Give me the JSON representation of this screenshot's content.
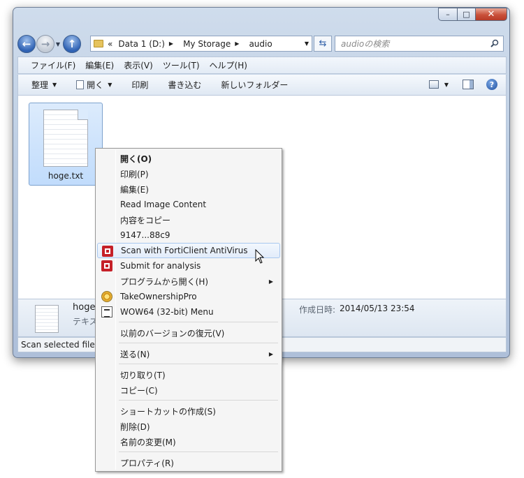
{
  "window": {
    "buttons": {
      "minimize": "–",
      "maximize": "□",
      "close": "✕"
    }
  },
  "nav": {
    "back": "←",
    "forward": "→",
    "up": "↑",
    "breadcrumb_prefix": "«",
    "breadcrumbs": [
      "Data 1 (D:)",
      "My Storage",
      "audio"
    ],
    "search_placeholder": "audioの検索"
  },
  "menubar": [
    "ファイル(F)",
    "編集(E)",
    "表示(V)",
    "ツール(T)",
    "ヘルプ(H)"
  ],
  "commandbar": {
    "organize": "整理",
    "open": "開く",
    "print": "印刷",
    "burn": "書き込む",
    "new_folder": "新しいフォルダー",
    "help": "?"
  },
  "file": {
    "name": "hoge.txt"
  },
  "details": {
    "name": "hoge",
    "type": "テキス",
    "created_label": "作成日時:",
    "created_value": "2014/05/13 23:54"
  },
  "status": {
    "text": "Scan selected files"
  },
  "context_menu": {
    "items": [
      {
        "label": "開く(O)"
      },
      {
        "label": "印刷(P)"
      },
      {
        "label": "編集(E)"
      },
      {
        "label": "Read Image Content"
      },
      {
        "label": "内容をコピー"
      },
      {
        "label": "9147...88c9"
      },
      {
        "label": "Scan with FortiClient AntiVirus",
        "icon": "forticlient-icon"
      },
      {
        "label": "Submit for analysis",
        "icon": "forticlient-icon"
      },
      {
        "label": "プログラムから開く(H)"
      },
      {
        "label": "TakeOwnershipPro",
        "icon": "gear-icon"
      },
      {
        "label": "WOW64 (32-bit) Menu",
        "icon": "wow64-icon"
      },
      {
        "label": "以前のバージョンの復元(V)"
      },
      {
        "label": "送る(N)"
      },
      {
        "label": "切り取り(T)"
      },
      {
        "label": "コピー(C)"
      },
      {
        "label": "ショートカットの作成(S)"
      },
      {
        "label": "削除(D)"
      },
      {
        "label": "名前の変更(M)"
      },
      {
        "label": "プロパティ(R)"
      }
    ]
  }
}
